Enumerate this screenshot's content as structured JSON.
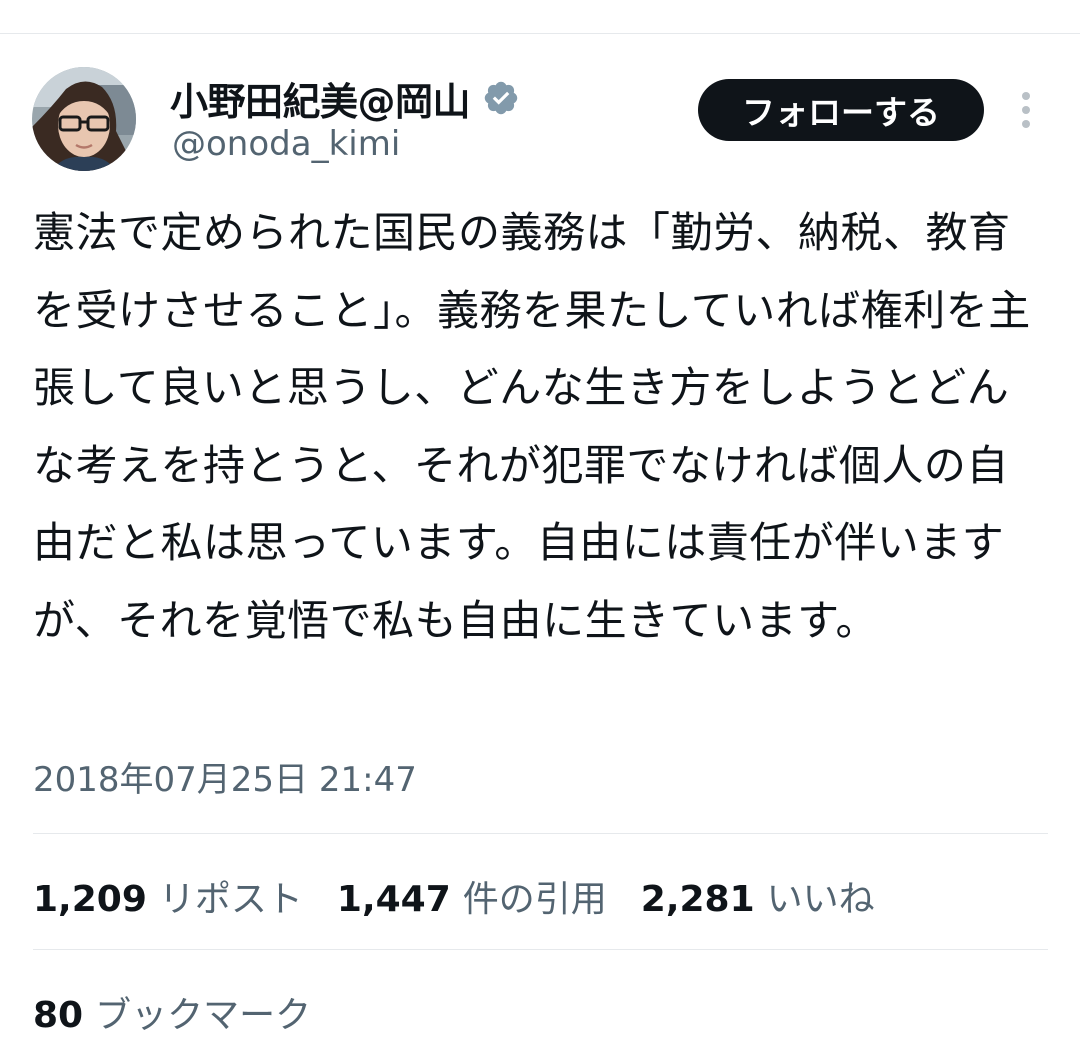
{
  "author": {
    "display_name": "小野田紀美@岡山",
    "handle": "@onoda_kimi",
    "verified_icon": "verified-badge-icon",
    "verified_color": "#829aab"
  },
  "actions": {
    "follow_label": "フォローする",
    "more_icon": "more-vertical-icon"
  },
  "tweet": {
    "text": "憲法で定められた国民の義務は「勤労、納税、教育を受けさせること」。義務を果たしていれば権利を主張して良いと思うし、どんな生き方をしようとどんな考えを持とうと、それが犯罪でなければ個人の自由だと私は思っています。自由には責任が伴いますが、それを覚悟で私も自由に生きています。",
    "timestamp": "2018年07月25日 21:47"
  },
  "stats": {
    "reposts": {
      "count": "1,209",
      "label": "リポスト"
    },
    "quotes": {
      "count": "1,447",
      "label": "件の引用"
    },
    "likes": {
      "count": "2,281",
      "label": "いいね"
    },
    "bookmarks": {
      "count": "80",
      "label": "ブックマーク"
    }
  },
  "colors": {
    "text_primary": "#0f1419",
    "text_secondary": "#536471",
    "divider": "#e6e9ec",
    "follow_bg": "#0f1419"
  }
}
